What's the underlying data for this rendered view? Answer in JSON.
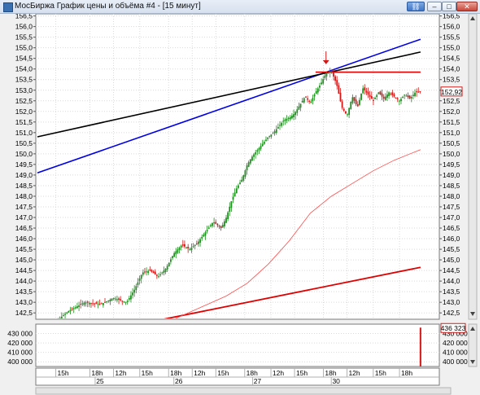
{
  "window": {
    "title": "МосБиржа График цены и объёма #4 - [15 минут]",
    "buttons": {
      "link": "⛓",
      "minimize": "–",
      "maximize": "□",
      "close": "✕"
    }
  },
  "chart_data": [
    {
      "type": "candlestick",
      "title": "",
      "ylim": [
        142.2,
        156.6
      ],
      "y_ticks": [
        "156,5",
        "156,0",
        "155,5",
        "155,0",
        "154,5",
        "154,0",
        "153,5",
        "153,0",
        "152,5",
        "152,0",
        "151,5",
        "151,0",
        "150,5",
        "150,0",
        "149,5",
        "149,0",
        "148,5",
        "148,0",
        "147,5",
        "147,0",
        "146,5",
        "146,0",
        "145,5",
        "145,0",
        "144,5",
        "144,0",
        "143,5",
        "143,0",
        "142,5"
      ],
      "y_tick_values": [
        156.5,
        156.0,
        155.5,
        155.0,
        154.5,
        154.0,
        153.5,
        153.0,
        152.5,
        152.0,
        151.5,
        151.0,
        150.5,
        150.0,
        149.5,
        149.0,
        148.5,
        148.0,
        147.5,
        147.0,
        146.5,
        146.0,
        145.5,
        145.0,
        144.5,
        144.0,
        143.5,
        143.0,
        142.5
      ],
      "last_price_label": "152,92",
      "last_price": 152.92,
      "colors": {
        "up": "#1e8f1e",
        "down": "#d01818",
        "blue_line": "#0000e6",
        "black_line": "#000000",
        "red_line": "#e00000",
        "ma_line": "#ff4a4a"
      },
      "close_path": [
        [
          0.0,
          142.0
        ],
        [
          2.0,
          141.8
        ],
        [
          6.0,
          142.6
        ],
        [
          9.0,
          143.0
        ],
        [
          12.0,
          142.9
        ],
        [
          14.5,
          143.2
        ],
        [
          17.0,
          143.0
        ],
        [
          18.5,
          143.6
        ],
        [
          20.0,
          144.4
        ],
        [
          21.5,
          144.5
        ],
        [
          23.0,
          144.2
        ],
        [
          24.5,
          144.6
        ],
        [
          26.0,
          145.3
        ],
        [
          27.5,
          145.7
        ],
        [
          29.0,
          145.5
        ],
        [
          30.5,
          145.8
        ],
        [
          32.0,
          146.3
        ],
        [
          33.5,
          146.8
        ],
        [
          35.0,
          146.5
        ],
        [
          36.0,
          147.0
        ],
        [
          37.0,
          147.8
        ],
        [
          38.0,
          148.4
        ],
        [
          39.0,
          148.8
        ],
        [
          40.0,
          149.5
        ],
        [
          41.0,
          149.9
        ],
        [
          42.0,
          150.2
        ],
        [
          43.0,
          150.5
        ],
        [
          44.0,
          150.8
        ],
        [
          45.0,
          151.0
        ],
        [
          46.0,
          151.3
        ],
        [
          47.0,
          151.6
        ],
        [
          48.0,
          151.7
        ],
        [
          49.0,
          151.9
        ],
        [
          50.0,
          152.3
        ],
        [
          51.0,
          152.7
        ],
        [
          52.0,
          152.4
        ],
        [
          53.0,
          152.9
        ],
        [
          54.0,
          153.3
        ],
        [
          55.0,
          153.8
        ],
        [
          56.0,
          153.9
        ],
        [
          57.0,
          153.3
        ],
        [
          58.0,
          152.2
        ],
        [
          59.0,
          151.8
        ],
        [
          60.0,
          152.7
        ],
        [
          61.0,
          152.2
        ],
        [
          62.0,
          153.1
        ],
        [
          63.0,
          152.8
        ],
        [
          64.0,
          152.5
        ],
        [
          65.0,
          152.9
        ],
        [
          66.0,
          152.6
        ],
        [
          67.0,
          152.9
        ],
        [
          68.0,
          152.7
        ],
        [
          69.0,
          152.5
        ],
        [
          70.0,
          152.8
        ],
        [
          71.0,
          152.6
        ],
        [
          72.0,
          152.9
        ],
        [
          73.0,
          152.92
        ]
      ],
      "overlays": [
        {
          "name": "",
          "kind": "blue_trendline",
          "points": [
            [
              0.0,
              149.1
            ],
            [
              73.0,
              155.4
            ]
          ]
        },
        {
          "name": "",
          "kind": "black_trendline",
          "points": [
            [
              0.0,
              150.8
            ],
            [
              73.0,
              154.8
            ]
          ]
        },
        {
          "name": "",
          "kind": "red_horizontal",
          "points": [
            [
              53.0,
              153.85
            ],
            [
              73.0,
              153.85
            ]
          ]
        },
        {
          "name": "",
          "kind": "red_support",
          "points": [
            [
              24.0,
              142.2
            ],
            [
              73.0,
              144.65
            ]
          ]
        },
        {
          "name": "",
          "kind": "moving_average",
          "points": [
            [
              26.0,
              142.2
            ],
            [
              36.0,
              143.3
            ],
            [
              40.0,
              143.9
            ],
            [
              44.0,
              144.8
            ],
            [
              48.0,
              145.9
            ],
            [
              52.0,
              147.2
            ],
            [
              56.0,
              148.0
            ],
            [
              60.0,
              148.6
            ],
            [
              64.0,
              149.2
            ],
            [
              68.0,
              149.7
            ],
            [
              73.0,
              150.2
            ]
          ]
        }
      ],
      "marker": {
        "label": "",
        "at": [
          55.0,
          154.3
        ]
      }
    },
    {
      "type": "bar",
      "title": "",
      "ylim": [
        395000,
        440000
      ],
      "y_ticks": [
        "430 000",
        "420 000",
        "410 000",
        "400 000"
      ],
      "y_tick_values": [
        430000,
        420000,
        410000,
        400000
      ],
      "last_value_label": "436 323",
      "last_value": 436323,
      "bars": [
        [
          73.0,
          436323
        ]
      ]
    }
  ],
  "x_axis": {
    "hour_labels": [
      "15h",
      "18h",
      "12h",
      "15h",
      "18h",
      "12h",
      "15h",
      "18h",
      "12h",
      "15h",
      "18h",
      "12h",
      "15h",
      "18h"
    ],
    "hour_positions": [
      3.5,
      10.0,
      14.5,
      19.5,
      25.0,
      29.5,
      34.0,
      39.5,
      44.5,
      49.0,
      54.5,
      59.0,
      64.0,
      69.0
    ],
    "day_labels": [
      "25",
      "26",
      "27",
      "30"
    ],
    "day_positions": [
      11.0,
      26.0,
      41.0,
      56.0
    ]
  }
}
